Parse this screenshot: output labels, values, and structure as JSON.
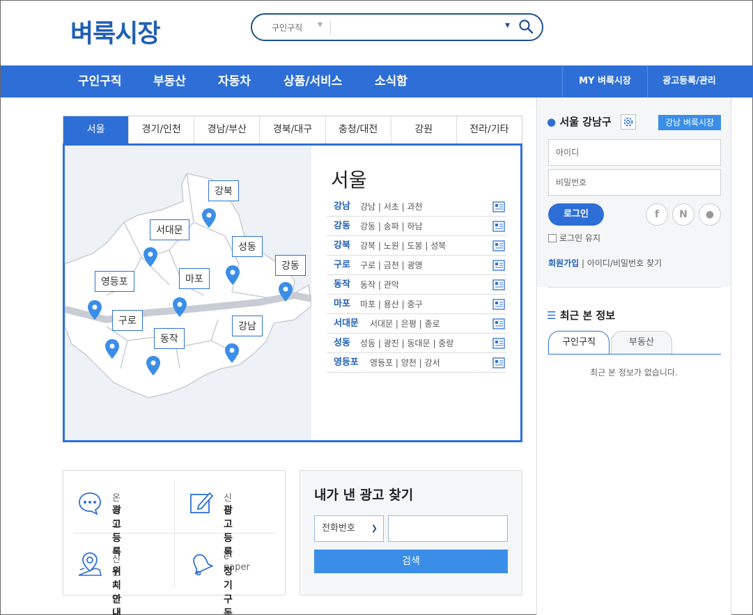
{
  "logo": "벼룩시장",
  "search": {
    "category": "구인구직",
    "value": ""
  },
  "nav": {
    "items": [
      "구인구직",
      "부동산",
      "자동차",
      "상품/서비스",
      "소식함"
    ],
    "right": [
      "MY 벼룩시장",
      "광고등록/관리"
    ]
  },
  "regions": {
    "tabs": [
      "서울",
      "경기/인천",
      "경남/부산",
      "경북/대구",
      "충청/대전",
      "강원",
      "전라/기타"
    ],
    "title": "서울",
    "map_labels": [
      "강북",
      "서대문",
      "성동",
      "강동",
      "영등포",
      "마포",
      "구로",
      "동작",
      "강남"
    ],
    "districts": [
      {
        "name": "강남",
        "subs": "강남 | 서초 | 과천"
      },
      {
        "name": "강동",
        "subs": "강동 | 송파 | 하남"
      },
      {
        "name": "강북",
        "subs": "강북 | 노원 | 도봉 | 성북"
      },
      {
        "name": "구로",
        "subs": "구로 | 금천 | 광명"
      },
      {
        "name": "동작",
        "subs": "동작 | 관악"
      },
      {
        "name": "마포",
        "subs": "마포 | 용산 | 중구"
      },
      {
        "name": "서대문",
        "subs": "서대문 | 은평 | 종로"
      },
      {
        "name": "성동",
        "subs": "성동 | 광진 | 동대문 | 중랑"
      },
      {
        "name": "영등포",
        "subs": "영등포 | 양천 | 강서"
      }
    ]
  },
  "services": [
    {
      "k1": "온라인",
      "k2": "광고등록",
      "icon": "chat-icon"
    },
    {
      "k1": "신문",
      "k2": "광고등록",
      "icon": "pencil-icon"
    },
    {
      "k1": "신문 배포대",
      "k2": "위치안내",
      "icon": "map-pin-icon"
    },
    {
      "k1": "e-paper",
      "k2": "정기구독",
      "icon": "bell-icon"
    }
  ],
  "find": {
    "title": "내가 낸 광고 찾기",
    "select": "전화번호",
    "button": "검색"
  },
  "sidebar": {
    "location": "서울 강남구",
    "location_button": "강남 벼룩시장",
    "id_placeholder": "아이디",
    "pw_placeholder": "비밀번호",
    "login": "로그인",
    "keep": "로그인 유지",
    "join": "회원가입",
    "find_account": "아이디/비밀번호 찾기",
    "recent_title": "최근 본 정보",
    "recent_tabs": [
      "구인구직",
      "부동산"
    ],
    "recent_empty": "최근 본 정보가 없습니다."
  },
  "colors": {
    "primary": "#2d6fd6",
    "logo": "#1f5fb5",
    "button": "#3a8ee8"
  }
}
